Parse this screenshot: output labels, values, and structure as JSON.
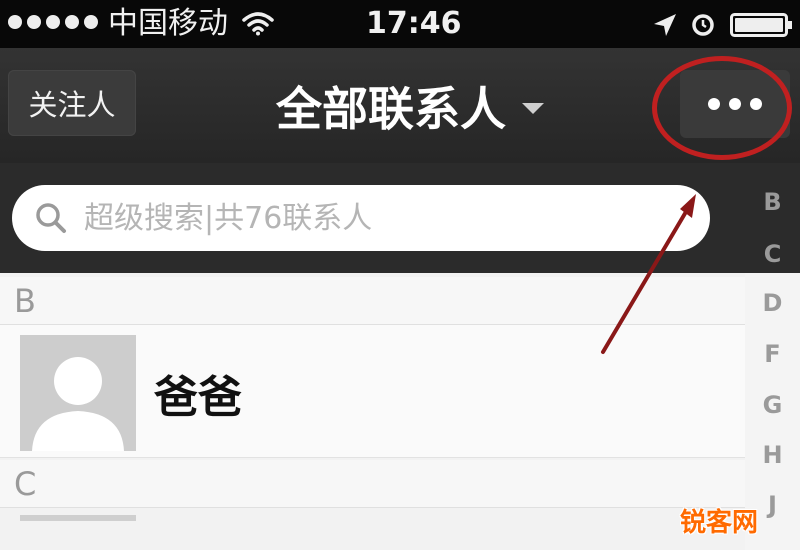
{
  "status_bar": {
    "carrier": "中国移动",
    "time": "17:46",
    "icons": [
      "signal-dots-icon",
      "wifi-icon",
      "location-arrow-icon",
      "alarm-icon",
      "battery-icon"
    ]
  },
  "nav": {
    "left_button": "关注人",
    "title": "全部联系人",
    "title_icon": "caret-down-icon",
    "right_button_icon": "more-dots-icon"
  },
  "search": {
    "placeholder": "超级搜索|共76联系人",
    "icon": "search-icon"
  },
  "index_letters": [
    "B",
    "C",
    "D",
    "F",
    "G",
    "H",
    "J"
  ],
  "sections": [
    {
      "letter": "B",
      "contacts": [
        {
          "name": "爸爸",
          "avatar": "default-avatar-icon"
        }
      ]
    },
    {
      "letter": "C",
      "contacts": []
    }
  ],
  "watermark": "锐客网",
  "colors": {
    "nav_background": "#2b2b2b",
    "annotation_red": "#c02020",
    "watermark_orange": "#ff6a00"
  }
}
